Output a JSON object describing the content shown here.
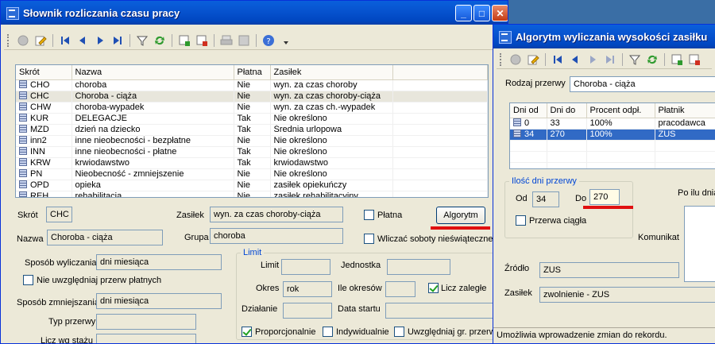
{
  "win1": {
    "title": "Słownik rozliczania czasu pracy",
    "columns": [
      "Skrót",
      "Nazwa",
      "Płatna",
      "Zasiłek"
    ],
    "rows": [
      [
        "CHO",
        "choroba",
        "Nie",
        "wyn. za czas choroby"
      ],
      [
        "CHC",
        "Choroba - ciąża",
        "Nie",
        "wyn. za czas choroby-ciąża"
      ],
      [
        "CHW",
        "choroba-wypadek",
        "Nie",
        "wyn. za czas ch.-wypadek"
      ],
      [
        "KUR",
        "DELEGACJE",
        "Tak",
        "Nie określono"
      ],
      [
        "MZD",
        "dzień na dziecko",
        "Tak",
        "Średnia urlopowa"
      ],
      [
        "inn2",
        "inne nieobecności - bezpłatne",
        "Nie",
        "Nie określono"
      ],
      [
        "INN",
        "inne nieobecności - płatne",
        "Tak",
        "Nie określono"
      ],
      [
        "KRW",
        "krwiodawstwo",
        "Tak",
        "krwiodawstwo"
      ],
      [
        "PN",
        "Nieobecność - zmniejszenie",
        "Nie",
        "Nie określono"
      ],
      [
        "OPD",
        "opieka",
        "Nie",
        "zasiłek opiekuńczy"
      ],
      [
        "REH",
        "rehabilitacja",
        "Nie",
        "zasiłek rehabilitacyjny"
      ]
    ],
    "form": {
      "skrot_label": "Skrót",
      "skrot_value": "CHC",
      "zasilek_label": "Zasiłek",
      "zasilek_value": "wyn. za czas choroby-ciąża",
      "platna_label": "Płatna",
      "algorytm_button": "Algorytm",
      "nazwa_label": "Nazwa",
      "nazwa_value": "Choroba - ciąża",
      "grupa_label": "Grupa",
      "grupa_value": "choroba",
      "wliczac_label": "Wliczać soboty nieświąteczne",
      "sposob_wyliczania_label": "Sposób wyliczania",
      "sposob_wyliczania_value": "dni miesiąca",
      "nie_uwzgledniaj_label": "Nie uwzględniaj przerw płatnych",
      "sposob_zmniejszania_label": "Sposób zmniejszania",
      "sposob_zmniejszania_value": "dni miesiąca",
      "typ_przerwy_label": "Typ przerwy",
      "licz_wg_stazu_label": "Licz wg stażu",
      "limit_group": "Limit",
      "limit_label": "Limit",
      "jednostka_label": "Jednostka",
      "okres_label": "Okres",
      "okres_value": "rok",
      "ile_okresow_label": "Ile okresów",
      "licz_zalegle_label": "Licz zaległe",
      "dzialanie_label": "Działanie",
      "data_startu_label": "Data startu",
      "proporcjonalnie_label": "Proporcjonalnie",
      "indywidualnie_label": "Indywidualnie",
      "uwzgledniaj_gr_label": "Uwzględniaj gr. przerw"
    }
  },
  "win2": {
    "title": "Algorytm wyliczania wysokości zasiłku",
    "rodzaj_label": "Rodzaj przerwy",
    "rodzaj_value": "Choroba - ciąża",
    "columns": [
      "Dni od",
      "Dni do",
      "Procent odpł.",
      "Płatnik"
    ],
    "rows": [
      [
        "0",
        "33",
        "100%",
        "pracodawca"
      ],
      [
        "34",
        "270",
        "100%",
        "ZUS"
      ]
    ],
    "ilosc_group": "Ilość dni przerwy",
    "od_label": "Od",
    "od_value": "34",
    "do_label": "Do",
    "do_value": "270",
    "przerwa_ciagla_label": "Przerwa ciągła",
    "po_ilu_label": "Po ilu dnia",
    "komunikat_label": "Komunikat",
    "zrodlo_label": "Źródło",
    "zrodlo_value": "ZUS",
    "zasilek_label": "Zasiłek",
    "zasilek_value": "zwolnienie - ZUS",
    "status": "Umożliwia wprowadzenie zmian do rekordu."
  },
  "colors": {
    "title_blue": "#0054e3",
    "selection": "#316ac5",
    "highlight_red": "#e01010"
  }
}
